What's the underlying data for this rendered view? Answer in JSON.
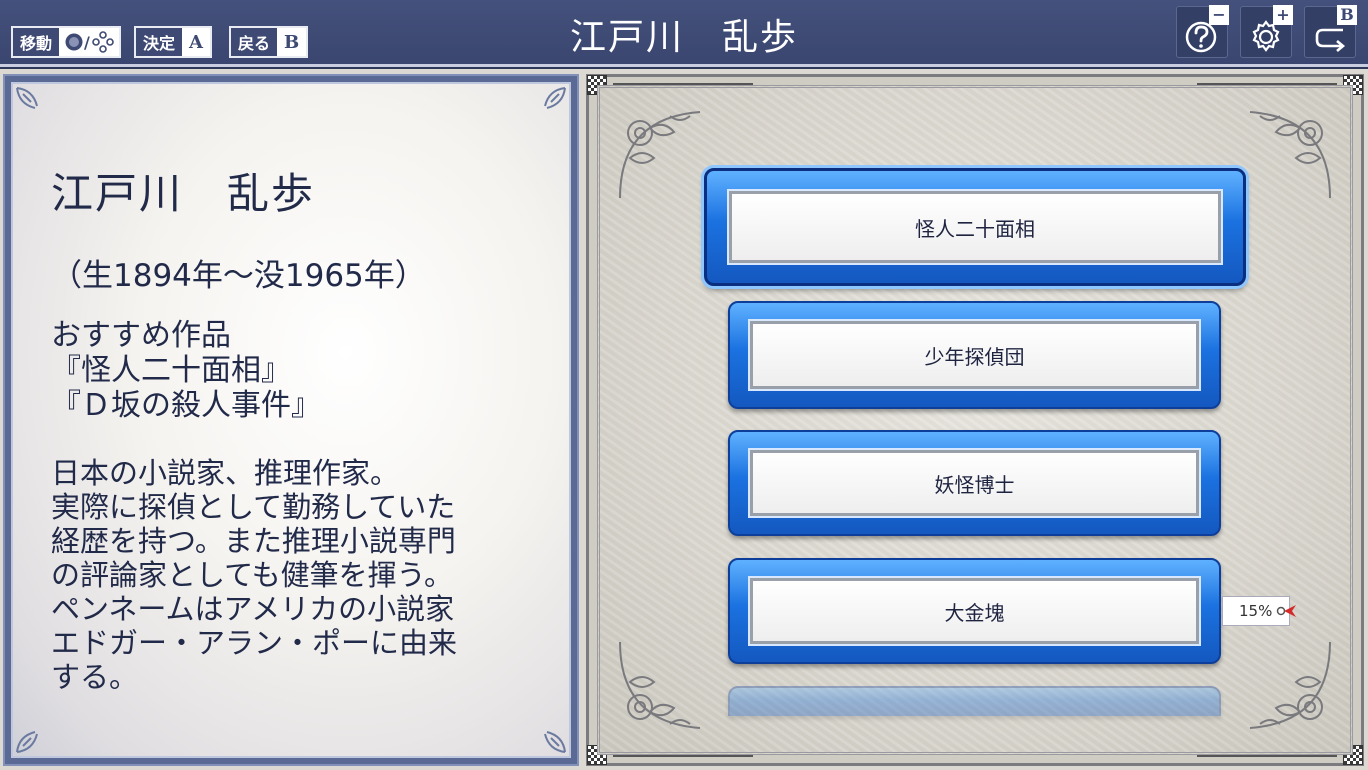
{
  "header": {
    "title": "江戸川　乱歩",
    "hints": [
      {
        "label": "移動",
        "key": "/"
      },
      {
        "label": "決定",
        "key": "A"
      },
      {
        "label": "戻る",
        "key": "B"
      }
    ],
    "buttons": [
      {
        "badge": "−",
        "icon": "help-icon"
      },
      {
        "badge": "+",
        "icon": "gear-icon"
      },
      {
        "badge": "B",
        "icon": "return-icon"
      }
    ]
  },
  "author": {
    "name": "江戸川　乱歩",
    "lifespan": "（生1894年～没1965年）",
    "recommended": [
      "おすすめ作品",
      "『怪人二十面相』",
      "『Ｄ坂の殺人事件』"
    ],
    "description": [
      "日本の小説家、推理作家。",
      "実際に探偵として勤務していた",
      "経歴を持つ。また推理小説専門",
      "の評論家としても健筆を揮う。",
      "ペンネームはアメリカの小説家",
      "エドガー・アラン・ポーに由来",
      "する。"
    ]
  },
  "works": [
    {
      "title": "怪人二十面相",
      "selected": true
    },
    {
      "title": "少年探偵団",
      "selected": false
    },
    {
      "title": "妖怪博士",
      "selected": false
    },
    {
      "title": "大金塊",
      "selected": false,
      "progress": "15%"
    }
  ],
  "colors": {
    "header_bg": "#3e4a73",
    "button_blue": "#1b72e0",
    "text_dark": "#222a4a"
  }
}
